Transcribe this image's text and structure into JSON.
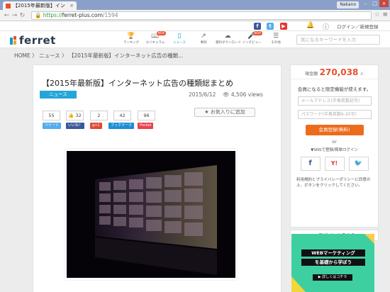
{
  "browser": {
    "tab_title": "【2015年最新版】イン",
    "tab_close": "×",
    "user": "Nakano",
    "url_lock": "🔒",
    "url_scheme": "https://",
    "url_host": "ferret-plus.com",
    "url_path": "/1594"
  },
  "topbar": {
    "social": [
      "f",
      "t",
      "▶"
    ],
    "login_label": "ログイン／新規登録"
  },
  "header": {
    "logo_text": "ferret",
    "nav": [
      {
        "label": "ランキング",
        "icon": "trophy-icon",
        "glyph": "🏆"
      },
      {
        "label": "カリキュラム",
        "icon": "book-icon",
        "glyph": "📖",
        "badge": "NEW"
      },
      {
        "label": "ニュース",
        "icon": "document-icon",
        "glyph": "▯",
        "active": true
      },
      {
        "label": "事例",
        "icon": "chart-icon",
        "glyph": "↗"
      },
      {
        "label": "資料ダウンロード",
        "icon": "download-icon",
        "glyph": "☁"
      },
      {
        "label": "インタビュー",
        "icon": "mic-icon",
        "glyph": "🎤",
        "badge": "NEW"
      },
      {
        "label": "その他",
        "icon": "menu-icon",
        "glyph": "☰"
      }
    ],
    "search_placeholder": "気になるキーワードを入力"
  },
  "breadcrumb": "HOME 〉 ニュース 〉 【2015年最新版】インターネット広告の種類...",
  "article": {
    "title": "【2015年最新版】インターネット広告の種類総まとめ",
    "category": "ニュース",
    "date": "2015/6/12",
    "views": "👁 4,506 views",
    "counts": [
      "55",
      "👍 32",
      "2",
      "42",
      "96"
    ],
    "share_buttons": [
      "ツイート",
      "いいね！",
      "g+1",
      "ブックマーク",
      "Pocket"
    ],
    "favorite_label": "★ お気入りに追加"
  },
  "sidebar": {
    "balance_label": "現金額",
    "balance_value": "270,038",
    "balance_unit": "人",
    "message": "会員になると限定機能が使えます。",
    "email_placeholder": "メールアドレス(半角英数記号)",
    "password_placeholder": "パスワード(半角英数6-20字)",
    "register_label": "会員登録(無料)",
    "or_label": "or",
    "sns_label": "▼SNSで登録/簡単ログイン",
    "sns_buttons": [
      "f",
      "Y!",
      "🐦"
    ],
    "note": "利用規約とプライバシーポリシーに同意の上、ボタンをクリックしてください。",
    "login_bar": "▶ ログインはこちら"
  },
  "ad": {
    "line1": "WEBマーケティング",
    "line2": "を基礎から学ぼう",
    "cta": "▶ 詳しくはコチラ"
  },
  "colors": {
    "brand_blue": "#0a9bd6",
    "accent_orange": "#e94f2d",
    "register_orange": "#ed6c1c",
    "ad_green": "#3ecfa0"
  }
}
